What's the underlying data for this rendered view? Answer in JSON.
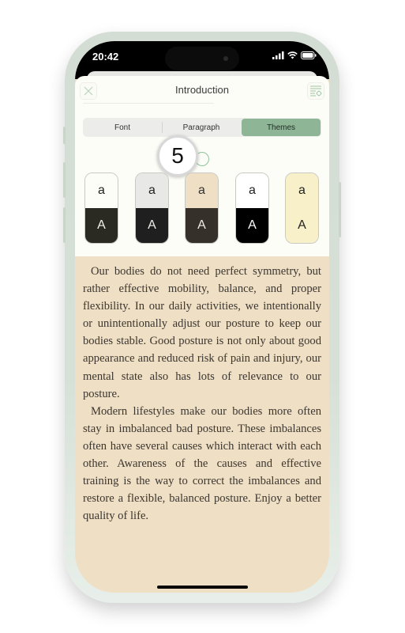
{
  "status_bar": {
    "time": "20:42",
    "icons": [
      "cellular-signal-icon",
      "wifi-icon",
      "battery-icon"
    ]
  },
  "header": {
    "title": "Introduction",
    "close_icon": "close-icon",
    "settings_icon": "text-settings-icon"
  },
  "tabs": [
    {
      "label": "Font",
      "active": false
    },
    {
      "label": "Paragraph",
      "active": false
    },
    {
      "label": "Themes",
      "active": true
    }
  ],
  "step_badge": "5",
  "themes": [
    {
      "name": "white-dark",
      "top_label": "a",
      "bottom_label": "A",
      "top_bg": "#fdfdf8",
      "bottom_bg": "#2b2a22",
      "top_fg": "#222",
      "bottom_fg": "#f0f0ea"
    },
    {
      "name": "gray-dark",
      "top_label": "a",
      "bottom_label": "A",
      "top_bg": "#e8e8e6",
      "bottom_bg": "#1f1f1f",
      "top_fg": "#222",
      "bottom_fg": "#f0f0ea"
    },
    {
      "name": "sepia-dark",
      "top_label": "a",
      "bottom_label": "A",
      "top_bg": "#efdfc4",
      "bottom_bg": "#36302a",
      "top_fg": "#333",
      "bottom_fg": "#f0ece4"
    },
    {
      "name": "white-black",
      "top_label": "a",
      "bottom_label": "A",
      "top_bg": "#ffffff",
      "bottom_bg": "#000000",
      "top_fg": "#222",
      "bottom_fg": "#ffffff"
    },
    {
      "name": "cream",
      "top_label": "a",
      "bottom_label": "A",
      "top_bg": "#f8f0c8",
      "bottom_bg": "#f8f0c8",
      "top_fg": "#222",
      "bottom_fg": "#222"
    }
  ],
  "content": {
    "paragraphs": [
      "Our bodies do not need perfect symmetry, but rather effective mobility, balance, and proper flexibility. In our daily activities, we intentionally or unintentionally adjust our posture to keep our bodies stable. Good posture is not only about good appearance and reduced risk of pain and injury, our mental state also has lots of relevance to our posture.",
      "Modern lifestyles make our bodies more often stay in imbalanced bad posture. These imbalances often have several causes which interact with each other. Awareness of the causes and effective training is the way to correct the imbalances and restore a flexible, balanced posture. Enjoy a better quality of life."
    ]
  },
  "colors": {
    "accent": "#8fb597",
    "reading_bg": "#efdfc4",
    "frame": "#d3ddd3"
  }
}
